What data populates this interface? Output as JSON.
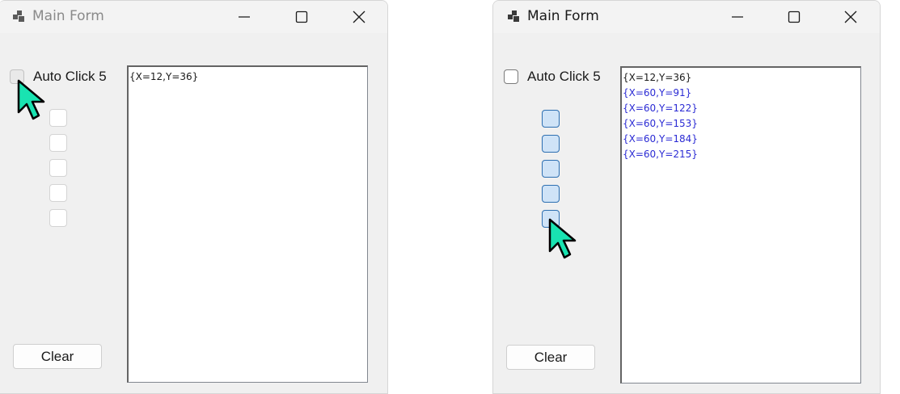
{
  "windows": [
    {
      "title": "Main Form",
      "autoclick_label": "Auto Click 5",
      "clear_label": "Clear",
      "log": [
        "{X=12,Y=36}"
      ]
    },
    {
      "title": "Main Form",
      "autoclick_label": "Auto Click 5",
      "clear_label": "Clear",
      "log": [
        "{X=12,Y=36}",
        "{X=60,Y=91}",
        "{X=60,Y=122}",
        "{X=60,Y=153}",
        "{X=60,Y=184}",
        "{X=60,Y=215}"
      ]
    }
  ],
  "colors": {
    "log_primary": "#1a1a1a",
    "log_auto": "#2b2bd4",
    "cursor_fill": "#19e3b1",
    "checked_fill": "#cfe3f7",
    "checked_border": "#2d6fb1"
  },
  "icons": {
    "app": "windows-form-icon",
    "minimize": "minimize-icon",
    "maximize": "maximize-icon",
    "close": "close-icon",
    "cursor": "mouse-pointer-icon"
  }
}
